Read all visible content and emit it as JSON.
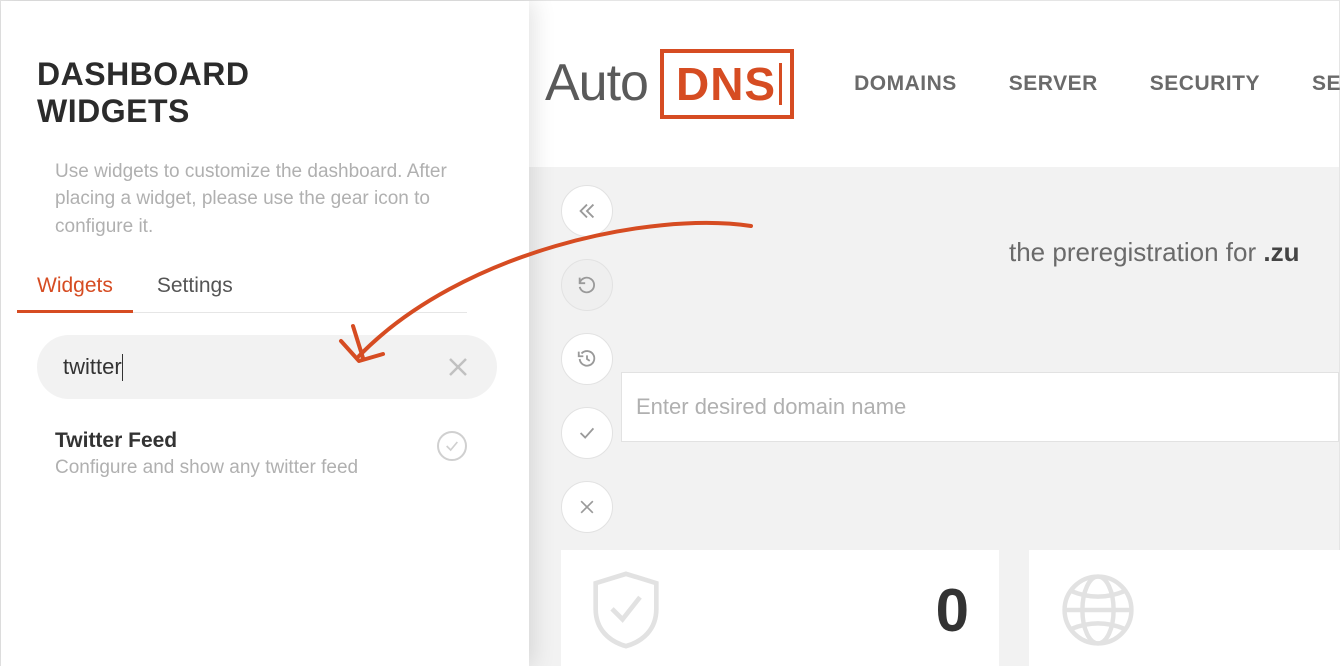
{
  "sidebar": {
    "title_line1": "DASHBOARD",
    "title_line2": "WIDGETS",
    "description": "Use widgets to customize the dashboard. After placing a widget, please use the gear icon to configure it.",
    "tabs": [
      {
        "label": "Widgets",
        "active": true
      },
      {
        "label": "Settings",
        "active": false
      }
    ],
    "search": {
      "value": "twitter",
      "placeholder": ""
    },
    "results": [
      {
        "title": "Twitter Feed",
        "subtitle": "Configure and show any twitter feed"
      }
    ]
  },
  "logo": {
    "left": "Auto",
    "right": "DNS"
  },
  "nav": [
    "DOMAINS",
    "SERVER",
    "SECURITY",
    "SE"
  ],
  "banner": {
    "prefix": "the preregistration for ",
    "bold": ".zu"
  },
  "domain_input": {
    "placeholder": "Enter desired domain name"
  },
  "cards": {
    "first_value": "0"
  },
  "colors": {
    "accent": "#d64c22"
  }
}
